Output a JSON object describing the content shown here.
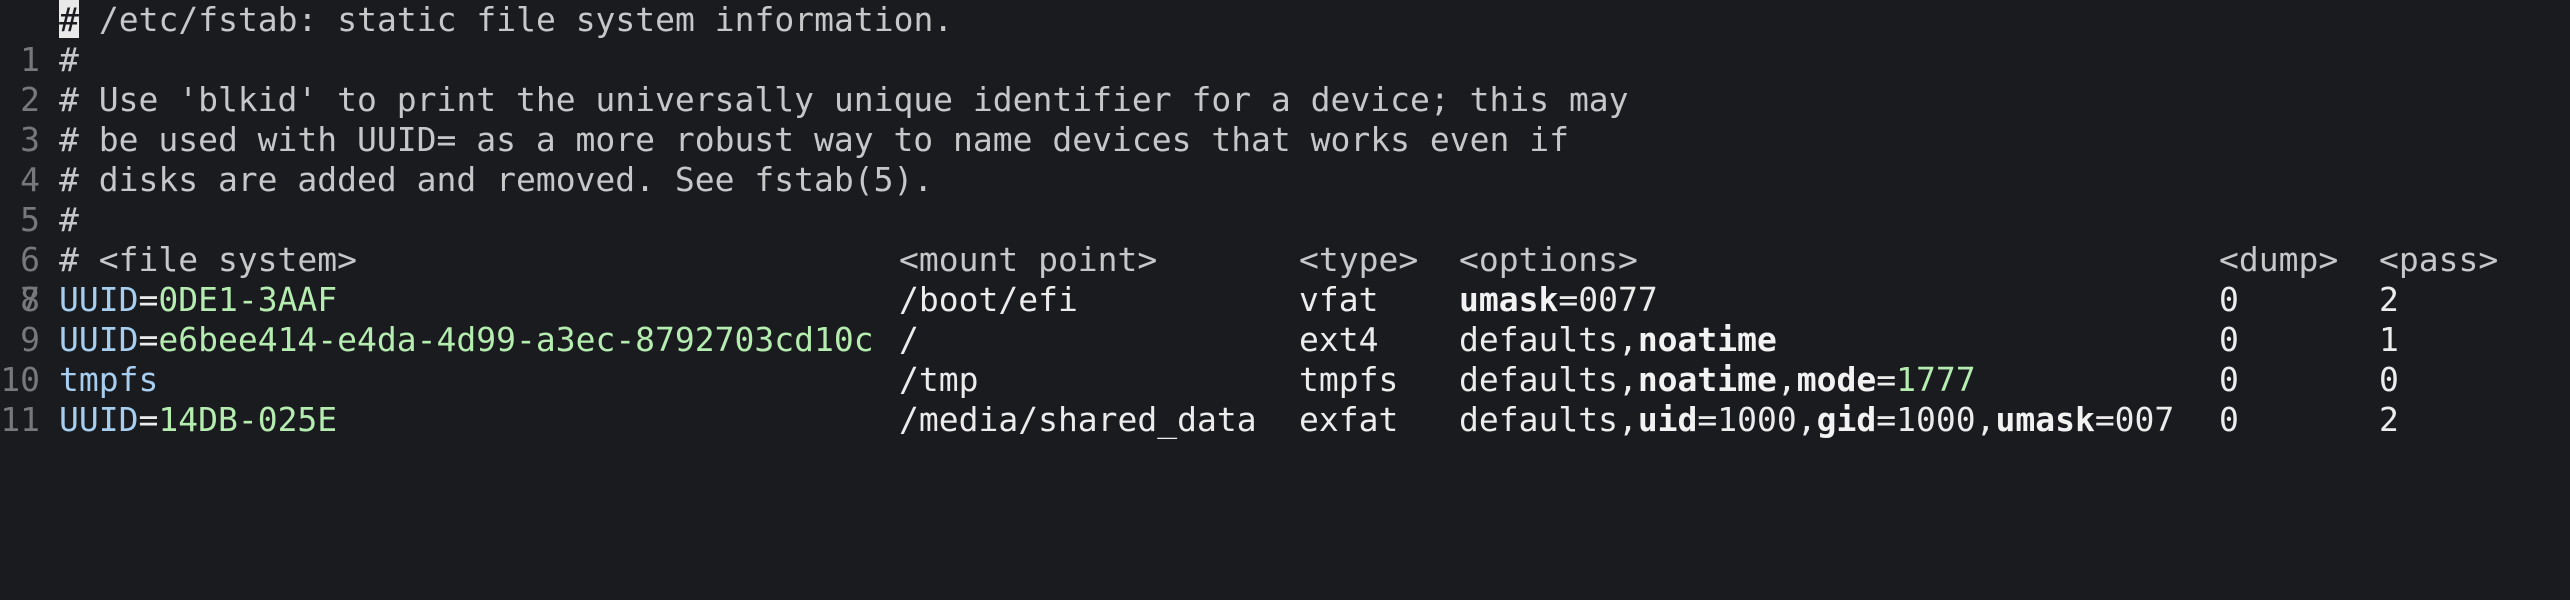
{
  "editor": {
    "lines": [
      {
        "num": "1",
        "cursor_char": "#",
        "text": " /etc/fstab: static file system information."
      },
      {
        "num": "2",
        "text": "#"
      },
      {
        "num": "3",
        "text": "# Use 'blkid' to print the universally unique identifier for a device; this may"
      },
      {
        "num": "4",
        "text": "# be used with UUID= as a more robust way to name devices that works even if"
      },
      {
        "num": "5",
        "text": "# disks are added and removed. See fstab(5)."
      },
      {
        "num": "6",
        "text": "#"
      },
      {
        "num": "7",
        "header": {
          "fs": "# <file system>",
          "mount": "<mount point>",
          "type": "<type>",
          "options": "<options>",
          "dump": "<dump>",
          "pass": "<pass>"
        }
      }
    ],
    "entries": [
      {
        "num": "8",
        "fs_key": "UUID",
        "fs_eq": "=",
        "fs_val": "0DE1-3AAF",
        "mount": "/boot/efi",
        "type": "vfat",
        "opt_parts": [
          {
            "t": "umask",
            "style": "bold"
          },
          {
            "t": "=0077",
            "style": "white"
          }
        ],
        "dump": "0",
        "pass": "2"
      },
      {
        "num": "9",
        "fs_key": "UUID",
        "fs_eq": "=",
        "fs_val": "e6bee414-e4da-4d99-a3ec-8792703cd10c",
        "mount": "/",
        "type": "ext4",
        "opt_parts": [
          {
            "t": "defaults,",
            "style": "white"
          },
          {
            "t": "noatime",
            "style": "bold"
          }
        ],
        "dump": "0",
        "pass": "1"
      },
      {
        "num": "10",
        "fs_key": "tmpfs",
        "fs_eq": "",
        "fs_val": "",
        "mount": "/tmp",
        "type": "tmpfs",
        "opt_parts": [
          {
            "t": "defaults,",
            "style": "white"
          },
          {
            "t": "noatime",
            "style": "bold"
          },
          {
            "t": ",",
            "style": "white"
          },
          {
            "t": "mode",
            "style": "bold"
          },
          {
            "t": "=",
            "style": "white"
          },
          {
            "t": "1777",
            "style": "green"
          }
        ],
        "dump": "0",
        "pass": "0"
      },
      {
        "num": "11",
        "fs_key": "UUID",
        "fs_eq": "=",
        "fs_val": "14DB-025E",
        "mount": "/media/shared_data",
        "type": "exfat",
        "opt_parts": [
          {
            "t": "defaults,",
            "style": "white"
          },
          {
            "t": "uid",
            "style": "bold"
          },
          {
            "t": "=1000,",
            "style": "white"
          },
          {
            "t": "gid",
            "style": "bold"
          },
          {
            "t": "=1000,",
            "style": "white"
          },
          {
            "t": "umask",
            "style": "bold"
          },
          {
            "t": "=007",
            "style": "white"
          }
        ],
        "dump": "0",
        "pass": "2"
      }
    ]
  }
}
